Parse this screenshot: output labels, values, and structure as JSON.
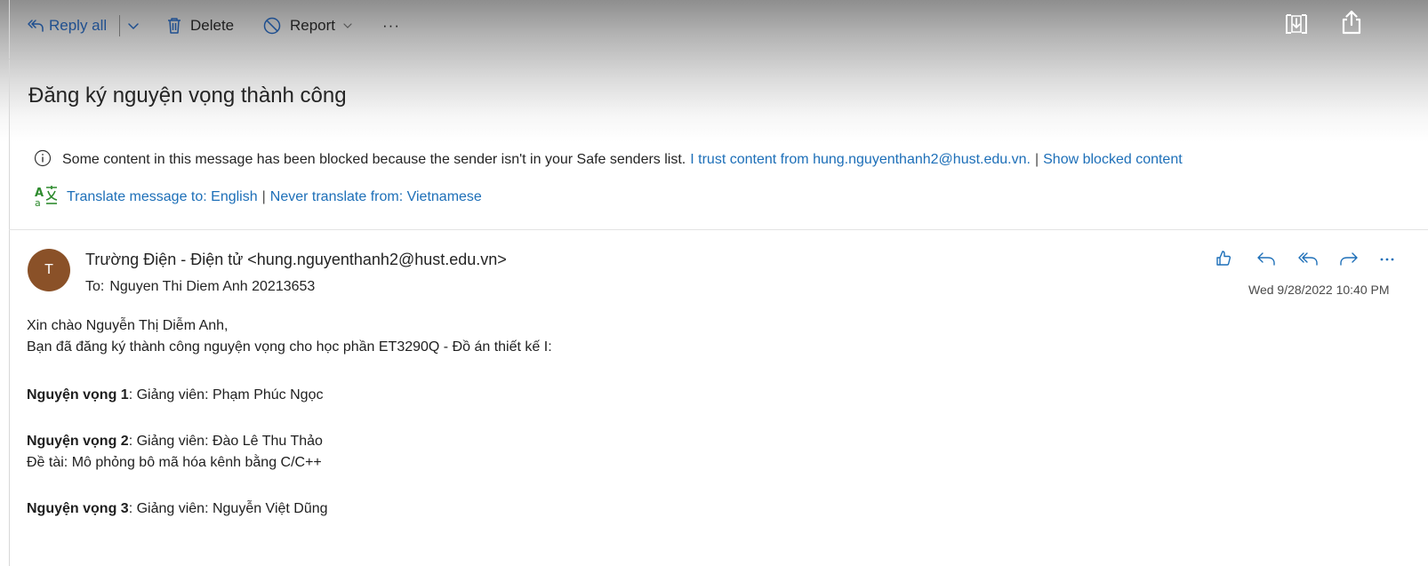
{
  "toolbar": {
    "reply_all_label": "Reply all",
    "delete_label": "Delete",
    "report_label": "Report",
    "more_label": "···",
    "icons": [
      "reply-all-icon",
      "chevron-down-icon",
      "trash-icon",
      "block-icon",
      "more-icon",
      "immersive-reader-icon",
      "share-icon"
    ]
  },
  "message": {
    "subject": "Đăng ký nguyện vọng thành công",
    "blocked_notice": {
      "text": "Some content in this message has been blocked because the sender isn't in your Safe senders list.",
      "trust_link": "I trust content from hung.nguyenthanh2@hust.edu.vn.",
      "separator": "|",
      "show_link": "Show blocked content"
    },
    "translate": {
      "translate_link": "Translate message to: English",
      "separator": "|",
      "never_link": "Never translate from: Vietnamese"
    },
    "sender": {
      "avatar_initial": "T",
      "avatar_color": "#8a5128",
      "from": "Trường Điện - Điện tử <hung.nguyenthanh2@hust.edu.vn>",
      "to_label": "To:",
      "to": "Nguyen Thi Diem Anh 20213653",
      "date": "Wed 9/28/2022 10:40 PM"
    },
    "actions": [
      "like-icon",
      "reply-icon",
      "reply-all-icon",
      "forward-icon",
      "more-icon"
    ],
    "body": {
      "greeting": "Xin chào Nguyễn Thị Diễm Anh,",
      "intro": "Bạn đã đăng ký thành công nguyện vọng cho học phần ET3290Q - Đồ án thiết kế I:",
      "choices": [
        {
          "label": "Nguyện vọng 1",
          "detail": ": Giảng viên: Phạm Phúc Ngọc"
        },
        {
          "label": "Nguyện vọng 2",
          "detail": ": Giảng viên: Đào Lê Thu Thảo",
          "topic": "Đề tài: Mô phỏng bô mã hóa kênh bằng C/C++"
        },
        {
          "label": "Nguyện vọng 3",
          "detail": ": Giảng viên: Nguyễn Việt Dũng"
        }
      ]
    }
  },
  "colors": {
    "link": "#1d6fb8",
    "toolbar_accent": "#1f4f8f",
    "avatar": "#8a5128"
  }
}
